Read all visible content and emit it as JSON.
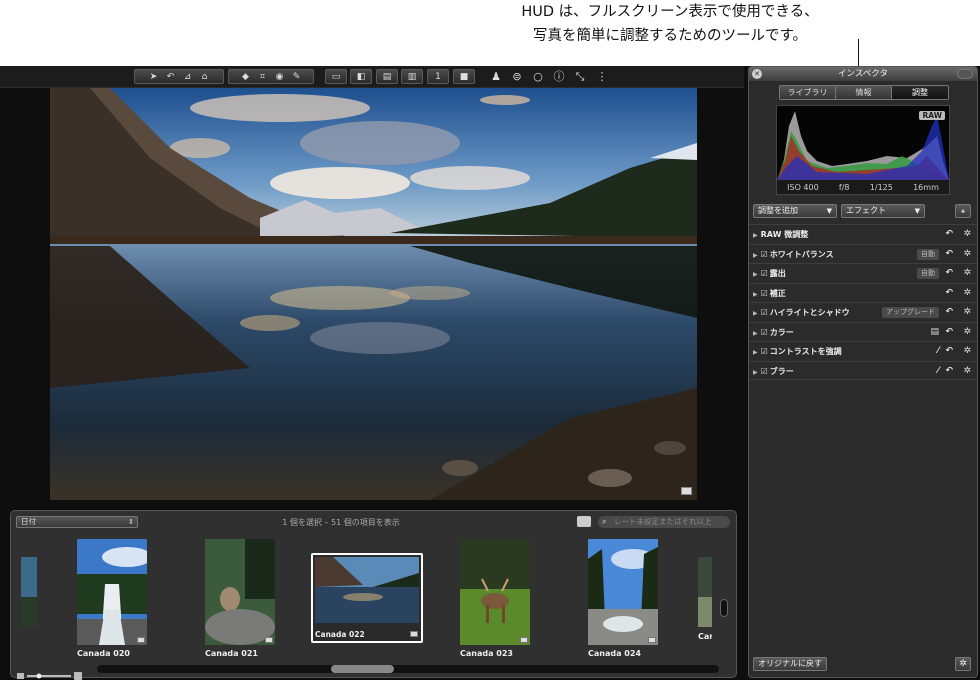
{
  "callout": {
    "line1": "HUD は、フルスクリーン表示で使用できる、",
    "line2": "写真を簡単に調整するためのツールです。"
  },
  "toolbar": {
    "group1": [
      "pointer-icon",
      "rotate-icon",
      "straighten-icon",
      "lift-stamp-icon"
    ],
    "group2": [
      "crop-icon",
      "redeye-icon",
      "brush-icon"
    ],
    "tools_right": [
      "viewer-icon",
      "split-view-icon",
      "compare-icon",
      "stack-icon",
      "info-icon",
      "full-screen-exit-icon"
    ]
  },
  "inspector": {
    "title": "インスペクタ",
    "tabs": [
      "ライブラリ",
      "情報",
      "調整"
    ],
    "active_tab": "調整",
    "raw_badge": "RAW",
    "exif": {
      "iso": "ISO 400",
      "aperture": "f/8",
      "shutter": "1/125",
      "focal": "16mm"
    },
    "add_adjustment": "調整を追加",
    "effects": "エフェクト",
    "adjustments": [
      {
        "label": "RAW 微調整",
        "checkbox": false,
        "button": ""
      },
      {
        "label": "ホワイトバランス",
        "checkbox": true,
        "button": "自動"
      },
      {
        "label": "露出",
        "checkbox": true,
        "button": "自動"
      },
      {
        "label": "補正",
        "checkbox": true,
        "button": ""
      },
      {
        "label": "ハイライトとシャドウ",
        "checkbox": true,
        "button": "アップグレード"
      },
      {
        "label": "カラー",
        "checkbox": true,
        "button": ""
      },
      {
        "label": "コントラストを強調",
        "checkbox": true,
        "button": ""
      },
      {
        "label": "ブラー",
        "checkbox": true,
        "button": ""
      }
    ],
    "revert": "オリジナルに戻す"
  },
  "browser": {
    "sort": "日付",
    "count": "1 個を選択 – 51 個の項目を表示",
    "search_placeholder": "レート未設定またはそれ以上",
    "thumbnails": [
      "Canada 020",
      "Canada 021",
      "Canada 022",
      "Canada 023",
      "Canada 024",
      "Cana"
    ],
    "selected": "Canada 022"
  }
}
